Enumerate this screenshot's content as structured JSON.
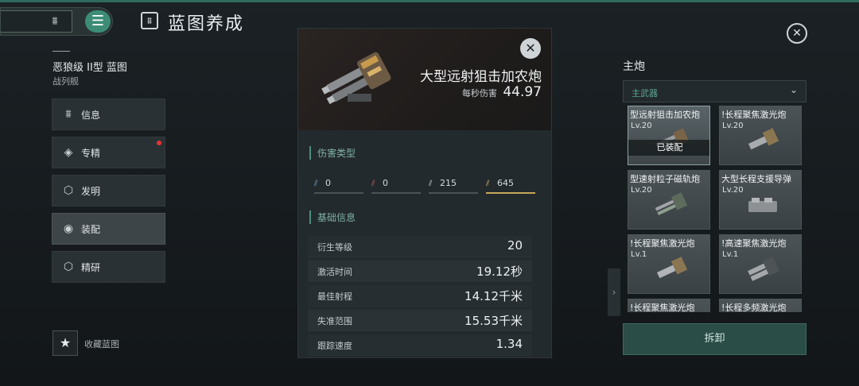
{
  "header": {
    "title": "蓝图养成"
  },
  "blueprint": {
    "name": "恶狼级 II型 蓝图",
    "type": "战列舰"
  },
  "nav": [
    {
      "label": "信息"
    },
    {
      "label": "专精",
      "has_notification": true
    },
    {
      "label": "发明"
    },
    {
      "label": "装配",
      "active": true
    },
    {
      "label": "精研"
    }
  ],
  "favorite": {
    "label": "收藏蓝图"
  },
  "weapon": {
    "name": "大型远射狙击加农炮",
    "dps_label": "每秒伤害",
    "dps_value": "44.97",
    "damage_section": "伤害类型",
    "damage": [
      "0",
      "0",
      "215",
      "645"
    ],
    "basic_section": "基础信息",
    "stats": [
      {
        "key": "衍生等级",
        "value": "20"
      },
      {
        "key": "激活时间",
        "value": "19.12秒"
      },
      {
        "key": "最佳射程",
        "value": "14.12千米"
      },
      {
        "key": "失准范围",
        "value": "15.53千米"
      },
      {
        "key": "跟踪速度",
        "value": "1.34"
      }
    ]
  },
  "right": {
    "title": "主炮",
    "dropdown_value": "主武器",
    "cards": [
      {
        "name": "型远射狙击加农炮",
        "level": "Lv.20",
        "equipped_label": "已装配"
      },
      {
        "name": "!长程聚焦激光炮",
        "level": "Lv.20"
      },
      {
        "name": "型速射粒子磁轨炮",
        "level": "Lv.20"
      },
      {
        "name": "大型长程支援导弹",
        "level": "Lv.20"
      },
      {
        "name": "!长程聚焦激光炮",
        "level": "Lv.1"
      },
      {
        "name": "!高速聚焦激光炮",
        "level": "Lv.1"
      },
      {
        "name": "!长程聚焦激光炮",
        "level": ""
      },
      {
        "name": "!长程多频激光炮",
        "level": ""
      }
    ],
    "uninstall_label": "拆卸"
  },
  "colors": {
    "accent": "#3c8c76",
    "notification": "#e5333a",
    "highlight_damage": "#c7a65a"
  }
}
